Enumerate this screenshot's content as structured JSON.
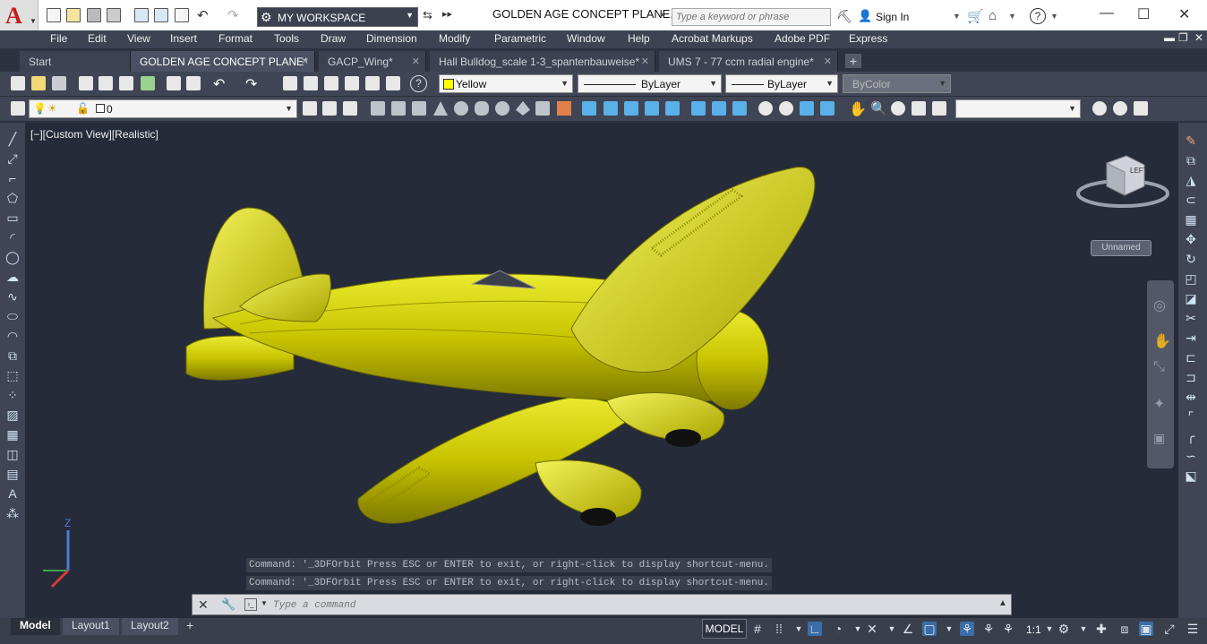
{
  "app": {
    "logo_letter": "A",
    "window_title": "GOLDEN AGE CONCEPT PLANE.d...",
    "workspace": "MY WORKSPACE",
    "search_placeholder": "Type a keyword or phrase",
    "sign_in": "Sign In"
  },
  "menu": [
    "File",
    "Edit",
    "View",
    "Insert",
    "Format",
    "Tools",
    "Draw",
    "Dimension",
    "Modify",
    "Parametric",
    "Window",
    "Help",
    "Acrobat Markups",
    "Adobe PDF",
    "Express"
  ],
  "tabs": [
    {
      "label": "Start",
      "active": false
    },
    {
      "label": "GOLDEN AGE CONCEPT PLANE*",
      "active": true
    },
    {
      "label": "GACP_Wing*",
      "active": false
    },
    {
      "label": "Hall Bulldog_scale 1-3_spantenbauweise*",
      "active": false
    },
    {
      "label": "UMS 7 - 77 ccm radial engine*",
      "active": false
    }
  ],
  "properties": {
    "color": "Yellow",
    "linetype": "ByLayer",
    "lineweight": "ByLayer",
    "plotstyle": "ByColor",
    "layer": "0"
  },
  "viewport": {
    "label": "[−][Custom View][Realistic]",
    "ucs_name": "Unnamed",
    "viewcube_face": "LEFT",
    "model_color": "#c8c400"
  },
  "command": {
    "history": [
      "Command: '_3DFOrbit Press ESC or ENTER to exit, or right-click to display shortcut-menu.",
      "Command: '_3DFOrbit Press ESC or ENTER to exit, or right-click to display shortcut-menu."
    ],
    "placeholder": "Type a command"
  },
  "layouts": [
    {
      "label": "Model",
      "active": true
    },
    {
      "label": "Layout1",
      "active": false
    },
    {
      "label": "Layout2",
      "active": false
    }
  ],
  "status": {
    "model": "MODEL",
    "scale": "1:1"
  }
}
